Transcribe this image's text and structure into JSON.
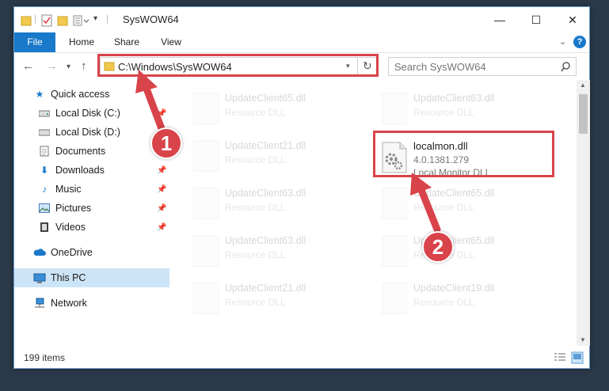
{
  "window": {
    "title": "SysWOW64",
    "controls": {
      "minimize": "—",
      "maximize": "☐",
      "close": "✕"
    }
  },
  "ribbon": {
    "tabs": [
      {
        "label": "File"
      },
      {
        "label": "Home"
      },
      {
        "label": "Share"
      },
      {
        "label": "View"
      }
    ],
    "expand_icon": "chevron-down-icon",
    "help": "?"
  },
  "navbar": {
    "address": "C:\\Windows\\SysWOW64",
    "search_placeholder": "Search SysWOW64"
  },
  "sidebar": {
    "items": [
      {
        "label": "Quick access",
        "icon": "star-icon",
        "pinned": false
      },
      {
        "label": "Local Disk (C:)",
        "icon": "drive-icon",
        "pinned": true
      },
      {
        "label": "Local Disk (D:)",
        "icon": "drive-icon",
        "pinned": false
      },
      {
        "label": "Documents",
        "icon": "document-icon",
        "pinned": true
      },
      {
        "label": "Downloads",
        "icon": "download-icon",
        "pinned": true
      },
      {
        "label": "Music",
        "icon": "music-icon",
        "pinned": true
      },
      {
        "label": "Pictures",
        "icon": "picture-icon",
        "pinned": true
      },
      {
        "label": "Videos",
        "icon": "video-icon",
        "pinned": true
      },
      {
        "label": "OneDrive",
        "icon": "cloud-icon",
        "pinned": false
      },
      {
        "label": "This PC",
        "icon": "computer-icon",
        "pinned": false,
        "selected": true
      },
      {
        "label": "Network",
        "icon": "network-icon",
        "pinned": false
      }
    ]
  },
  "files": [
    {
      "name": "UpdateClient65.dll",
      "desc": "Resource DLL",
      "faded": true
    },
    {
      "name": "UpdateClient63.dll",
      "desc": "Resource DLL",
      "faded": true
    },
    {
      "name": "UpdateClient21.dll",
      "desc": "Resource DLL",
      "faded": true
    },
    {
      "name": "localmon.dll",
      "desc": "4.0.1381.279",
      "desc2": "Local Monitor DLL",
      "faded": false
    },
    {
      "name": "UpdateClient63.dll",
      "desc": "Resource DLL",
      "faded": true
    },
    {
      "name": "UpdateClient65.dll",
      "desc": "Resource DLL",
      "faded": true
    },
    {
      "name": "UpdateClient63.dll",
      "desc": "Resource DLL",
      "faded": true
    },
    {
      "name": "UpdateClient65.dll",
      "desc": "Resource DLL",
      "faded": true
    },
    {
      "name": "UpdateClient21.dll",
      "desc": "Resource DLL",
      "faded": true
    },
    {
      "name": "UpdateClient19.dll",
      "desc": "Resource DLL",
      "faded": true
    }
  ],
  "status": {
    "item_count": "199 items"
  },
  "annotations": {
    "step1": "1",
    "step2": "2",
    "color": "#d9434a"
  }
}
